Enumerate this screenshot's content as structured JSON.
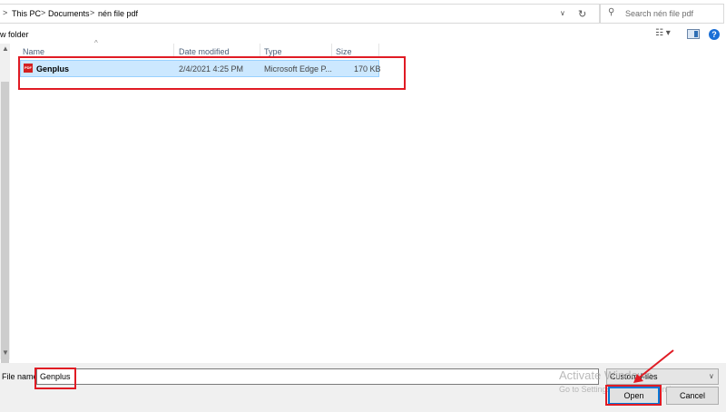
{
  "breadcrumb": {
    "items": [
      "This PC",
      "Documents",
      "nén file pdf"
    ],
    "separators": [
      ">",
      ">",
      ">",
      ">"
    ]
  },
  "search": {
    "placeholder": "Search nén file pdf"
  },
  "toolbar": {
    "new_folder_label": "w folder"
  },
  "columns": [
    "Name",
    "Date modified",
    "Type",
    "Size"
  ],
  "files": [
    {
      "name": "Genplus",
      "date_modified": "2/4/2021 4:25 PM",
      "type": "Microsoft Edge P...",
      "size": "170 KB",
      "icon": "pdf-file-icon",
      "icon_text": "PDF"
    }
  ],
  "bottom": {
    "file_name_label": "File name:",
    "file_name_value": "Genplus",
    "filter_value": "Custom Files",
    "open_label": "Open",
    "cancel_label": "Cancel"
  },
  "watermark": {
    "line1": "Activate Windows",
    "line2": "Go to Settings to activate Windows."
  },
  "icons": {
    "help": "?",
    "help_color": "#1a6fd6",
    "highlight_color": "#e01b24",
    "selection_color": "#cce8ff"
  }
}
